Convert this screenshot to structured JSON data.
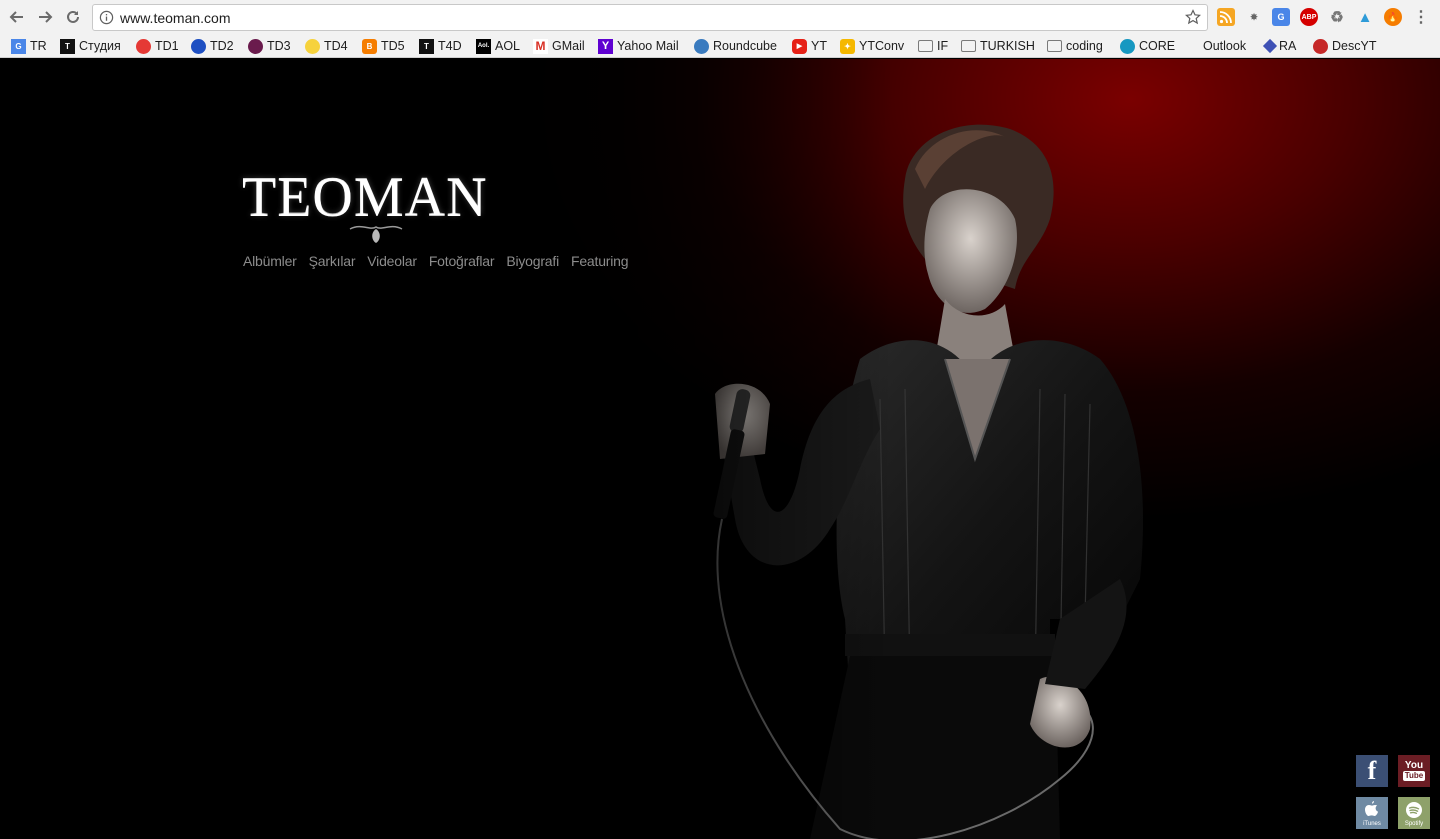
{
  "browser": {
    "url": "www.teoman.com"
  },
  "bookmarks": [
    {
      "label": "TR",
      "icon": "google-translate-icon",
      "color": "#4a86e8"
    },
    {
      "label": "Студия",
      "icon": "t4d-icon",
      "color": "#111111"
    },
    {
      "label": "TD1",
      "icon": "red-circle-icon",
      "color": "#e53935"
    },
    {
      "label": "TD2",
      "icon": "blue-circle-icon",
      "color": "#1e4fc2"
    },
    {
      "label": "TD3",
      "icon": "purple-circle-icon",
      "color": "#6a1b4d"
    },
    {
      "label": "TD4",
      "icon": "yellow-circle-icon",
      "color": "#f6d23c"
    },
    {
      "label": "TD5",
      "icon": "blogger-icon",
      "color": "#f57d00"
    },
    {
      "label": "T4D",
      "icon": "t4d-icon",
      "color": "#111111"
    },
    {
      "label": "AOL",
      "icon": "aol-icon",
      "color": "#000000"
    },
    {
      "label": "GMail",
      "icon": "gmail-icon",
      "color": "#d93025"
    },
    {
      "label": "Yahoo Mail",
      "icon": "yahoo-icon",
      "color": "#5f01d1"
    },
    {
      "label": "Roundcube",
      "icon": "roundcube-icon",
      "color": "#3a7bbf"
    },
    {
      "label": "YT",
      "icon": "youtube-icon",
      "color": "#e62117"
    },
    {
      "label": "YTConv",
      "icon": "ytconv-icon",
      "color": "#f5b800"
    },
    {
      "label": "IF",
      "icon": "folder-icon",
      "color": "#8a8a8a"
    },
    {
      "label": "TURKISH",
      "icon": "folder-icon",
      "color": "#8a8a8a"
    },
    {
      "label": "coding",
      "icon": "folder-icon",
      "color": "#8a8a8a"
    },
    {
      "label": "CORE",
      "icon": "salesforce-icon",
      "color": "#1798c1"
    },
    {
      "label": "Outlook",
      "icon": "microsoft-icon",
      "color": "#f25022"
    },
    {
      "label": "RA",
      "icon": "ra-icon",
      "color": "#3f51b5"
    },
    {
      "label": "DescYT",
      "icon": "tomato-icon",
      "color": "#c62828"
    }
  ],
  "site": {
    "logo": "TEOMAN",
    "menu": [
      "Albümler",
      "Şarkılar",
      "Videolar",
      "Fotoğraflar",
      "Biyografi",
      "Featuring"
    ],
    "social": {
      "facebook": "f",
      "youtube_top": "You",
      "youtube_bottom": "Tube",
      "itunes_label": "iTunes",
      "spotify_label": "Spotify"
    }
  },
  "colors": {
    "accent_red": "#7a0000",
    "menu_text": "#8c8c8c",
    "facebook_bg": "#3b4f74",
    "youtube_bg": "#6b1d24",
    "itunes_bg": "#6f8aa3",
    "spotify_bg": "#8ea16a"
  }
}
